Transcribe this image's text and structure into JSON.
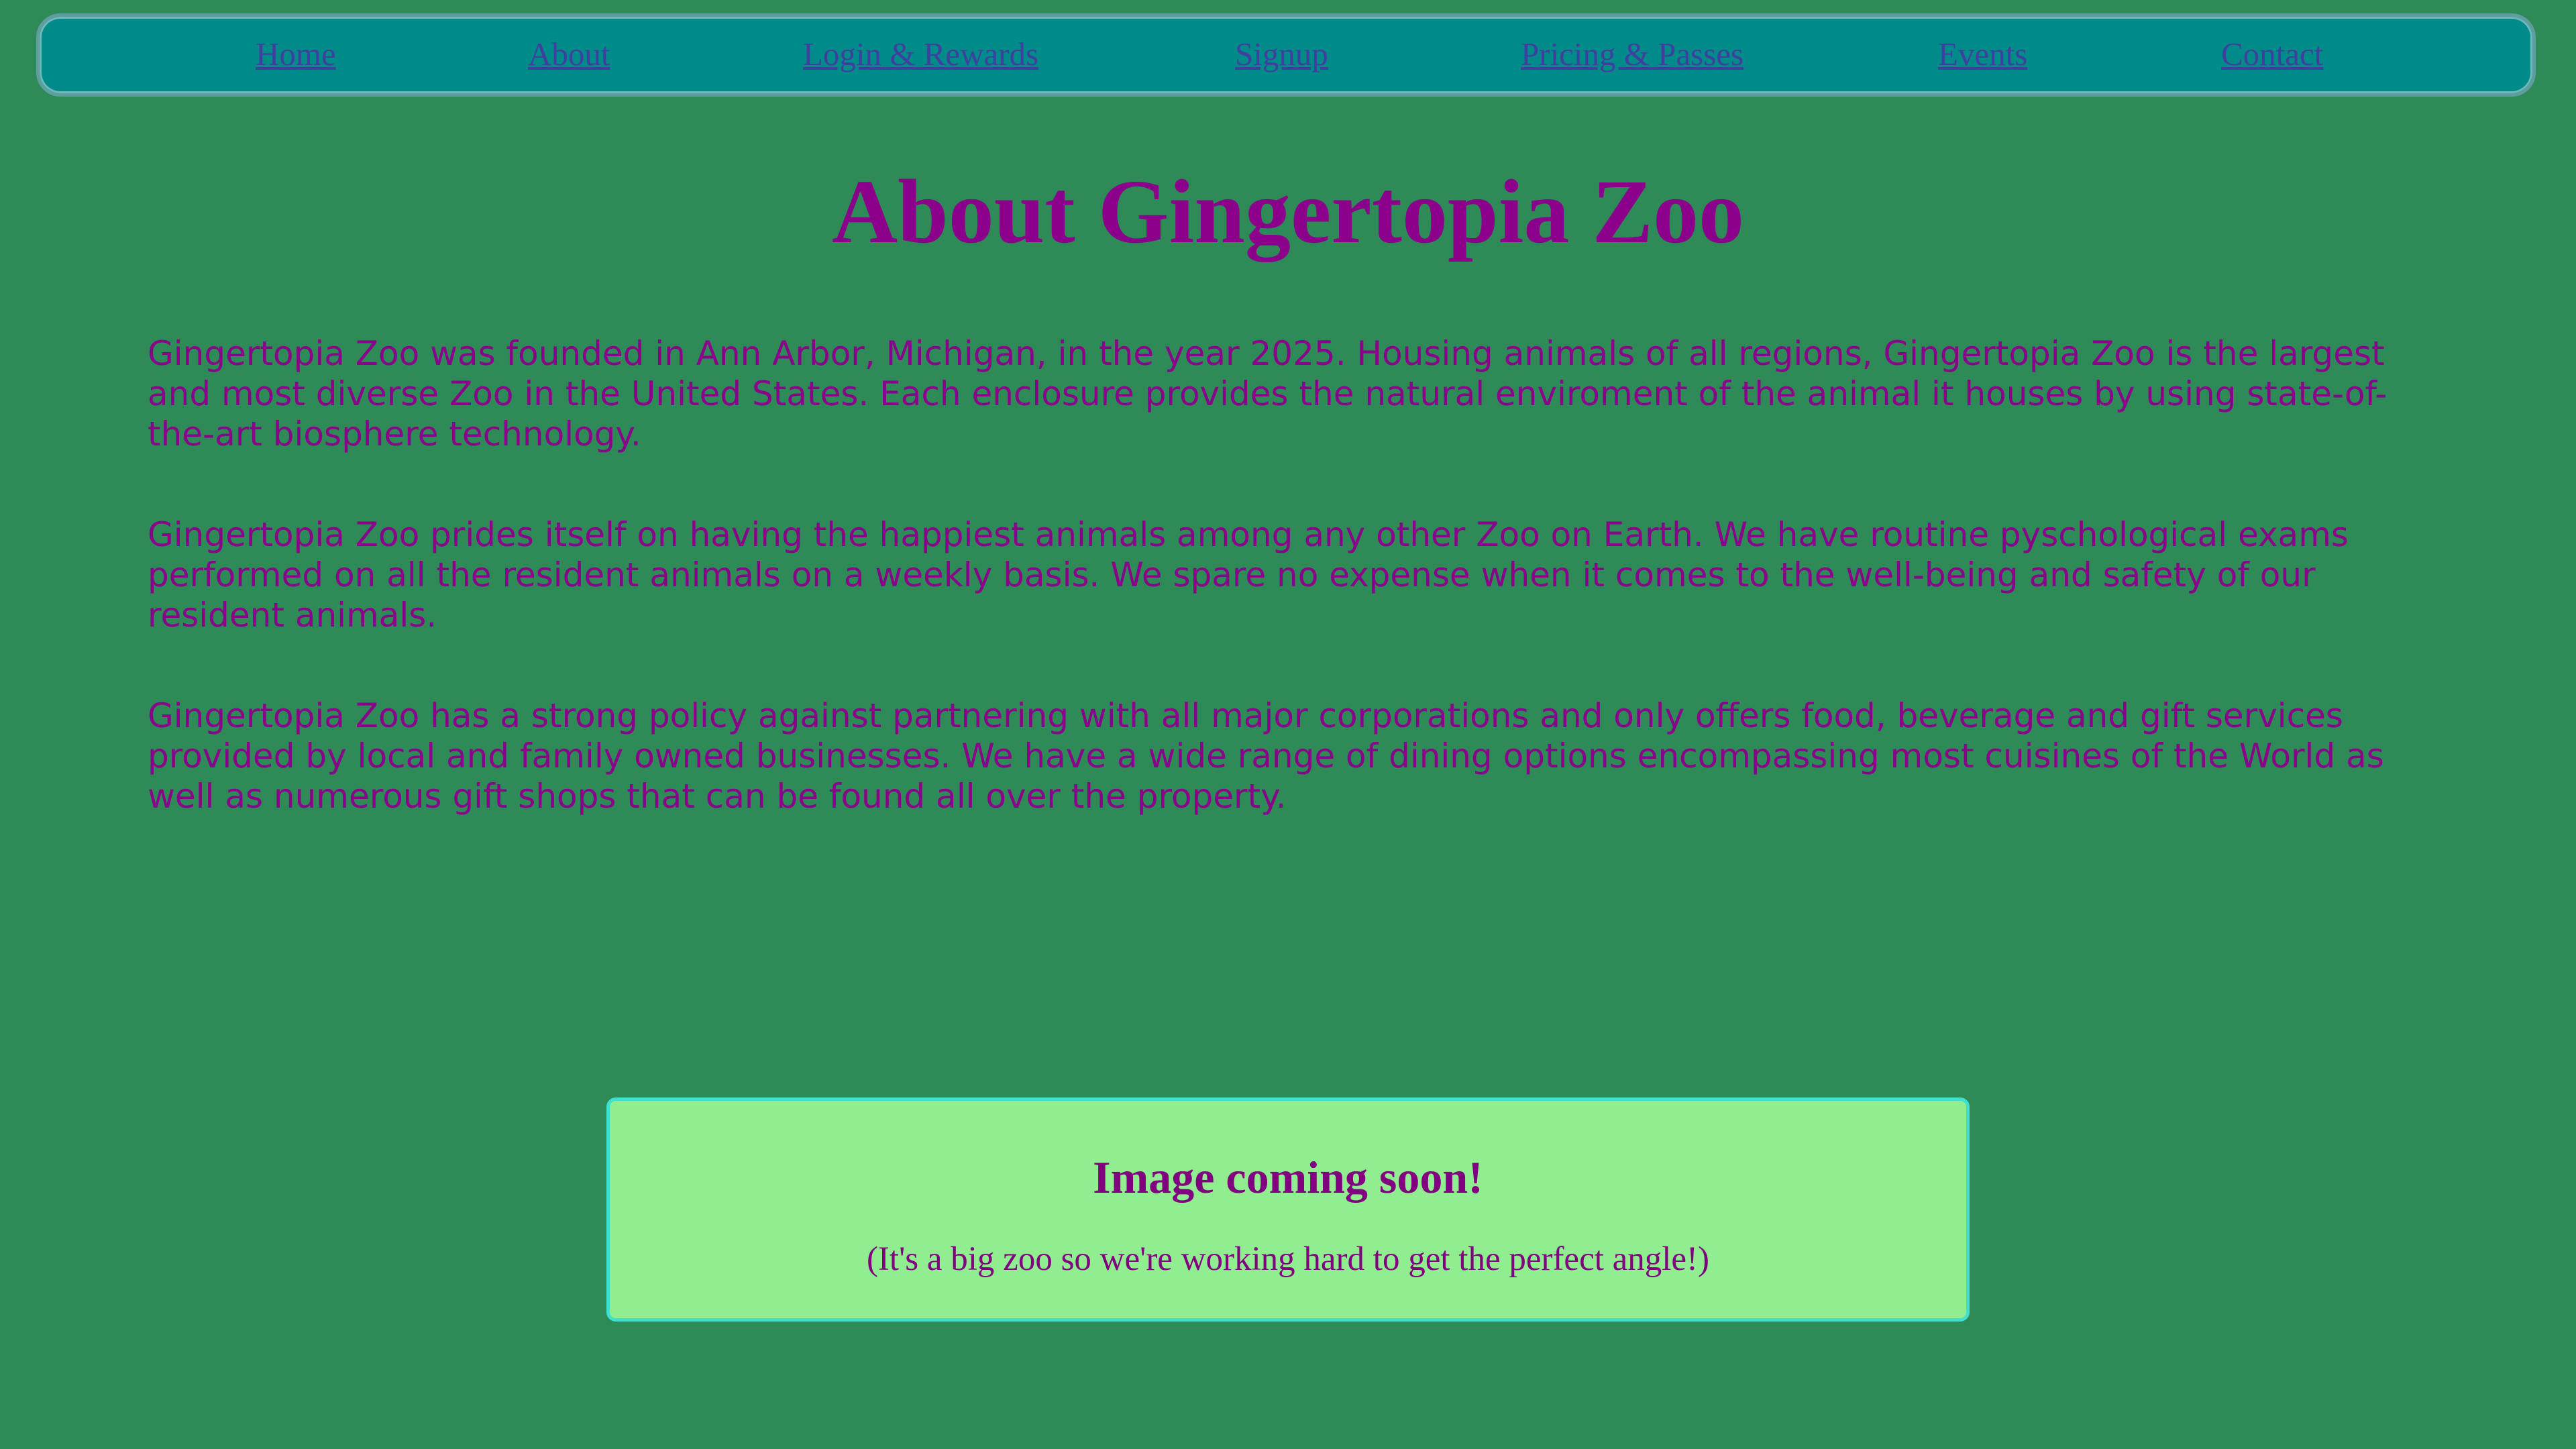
{
  "nav": {
    "items": [
      {
        "label": "Home"
      },
      {
        "label": "About"
      },
      {
        "label": "Login & Rewards"
      },
      {
        "label": "Signup"
      },
      {
        "label": "Pricing & Passes"
      },
      {
        "label": "Events"
      },
      {
        "label": "Contact"
      }
    ]
  },
  "page": {
    "title": "About Gingertopia Zoo",
    "paragraphs": [
      "Gingertopia Zoo was founded in Ann Arbor, Michigan, in the year 2025. Housing animals of all regions, Gingertopia Zoo is the largest and most diverse Zoo in the United States. Each enclosure provides the natural enviroment of the animal it houses by using state-of-the-art biosphere technology.",
      "Gingertopia Zoo prides itself on having the happiest animals among any other Zoo on Earth. We have routine pyschological exams performed on all the resident animals on a weekly basis. We spare no expense when it comes to the well-being and safety of our resident animals.",
      "Gingertopia Zoo has a strong policy against partnering with all major corporations and only offers food, beverage and gift services provided by local and family owned businesses. We have a wide range of dining options encompassing most cuisines of the World as well as numerous gift shops that can be found all over the property."
    ]
  },
  "placeholder": {
    "title": "Image coming soon!",
    "subtitle": "(It's a big zoo so we're working hard to get the perfect angle!)"
  },
  "colors": {
    "background": "#2e8b57",
    "navbar": "#008b8b",
    "text": "#8b008b",
    "link": "#3f3f9f",
    "box_background": "#90ee90",
    "box_border": "#40e0d0"
  }
}
